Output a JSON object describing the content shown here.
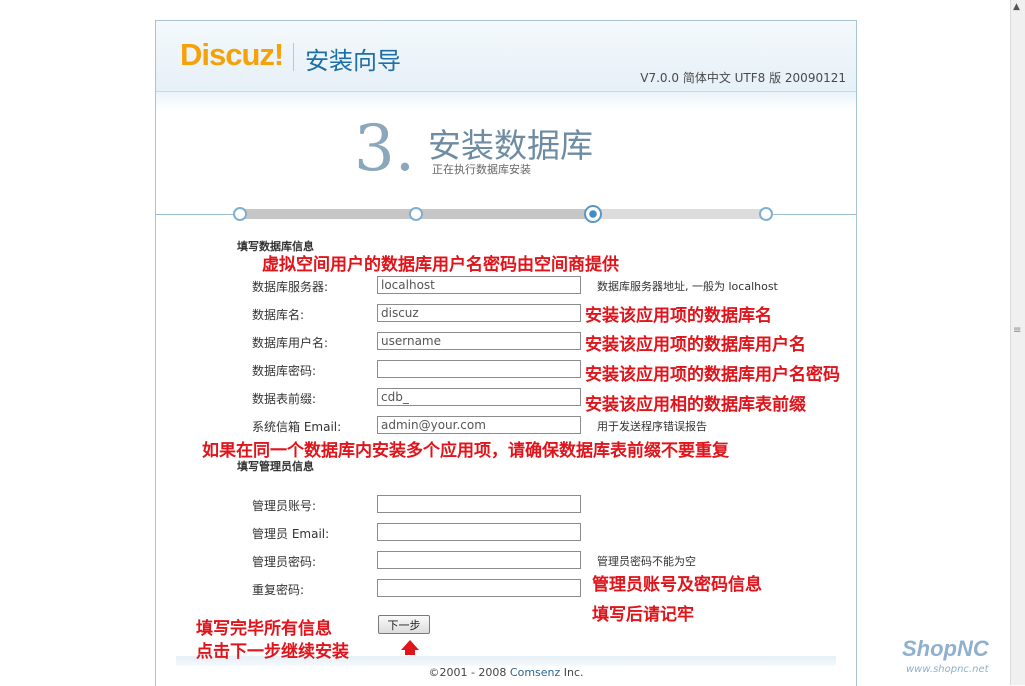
{
  "header": {
    "logo_text": "Discuz!",
    "title": "安装向导",
    "version": "V7.0.0 简体中文 UTF8 版 20090121"
  },
  "step": {
    "number": "3.",
    "title": "安装数据库",
    "subtitle": "正在执行数据库安装",
    "current_step": 3,
    "total_steps": 4
  },
  "db_section": {
    "title": "填写数据库信息",
    "fields": [
      {
        "label": "数据库服务器:",
        "value": "localhost",
        "hint": "数据库服务器地址, 一般为  localhost"
      },
      {
        "label": "数据库名:",
        "value": "discuz",
        "hint": ""
      },
      {
        "label": "数据库用户名:",
        "value": "username",
        "hint": ""
      },
      {
        "label": "数据库密码:",
        "value": "",
        "hint": ""
      },
      {
        "label": "数据表前缀:",
        "value": "cdb_",
        "hint": ""
      },
      {
        "label": "系统信箱  Email:",
        "value": "admin@your.com",
        "hint": "用于发送程序错误报告"
      }
    ]
  },
  "admin_section": {
    "title": "填写管理员信息",
    "fields": [
      {
        "label": "管理员账号:",
        "value": "",
        "hint": ""
      },
      {
        "label": "管理员  Email:",
        "value": "",
        "hint": ""
      },
      {
        "label": "管理员密码:",
        "value": "",
        "hint": "管理员密码不能为空"
      },
      {
        "label": "重复密码:",
        "value": "",
        "hint": ""
      }
    ]
  },
  "next_button": "下一步",
  "footer": {
    "copyright_prefix": "©2001 - 2008 ",
    "company": "Comsenz",
    "suffix": " Inc."
  },
  "annotations": {
    "db_info": "虚拟空间用户的数据库用户名密码由空间商提供",
    "db_name": "安装该应用项的数据库名",
    "db_user": "安装该应用项的数据库用户名",
    "db_pass": "安装该应用项的数据库用户名密码",
    "db_prefix": "安装该应用相的数据库表前缀",
    "prefix_warning": "如果在同一个数据库内安装多个应用项，请确保数据库表前缀不要重复",
    "admin_info": "管理员账号及密码信息",
    "remember": "填写后请记牢",
    "fill_all": "填写完毕所有信息",
    "click_next": "点击下一步继续安装"
  },
  "watermark": {
    "brand": "ShopNC",
    "url": "www.shopnc.net"
  },
  "colors": {
    "logo_orange": "#f5a20a",
    "title_blue": "#1d6fa5",
    "annotation_red": "#e0141b",
    "frame_border": "#a9c3d6"
  }
}
